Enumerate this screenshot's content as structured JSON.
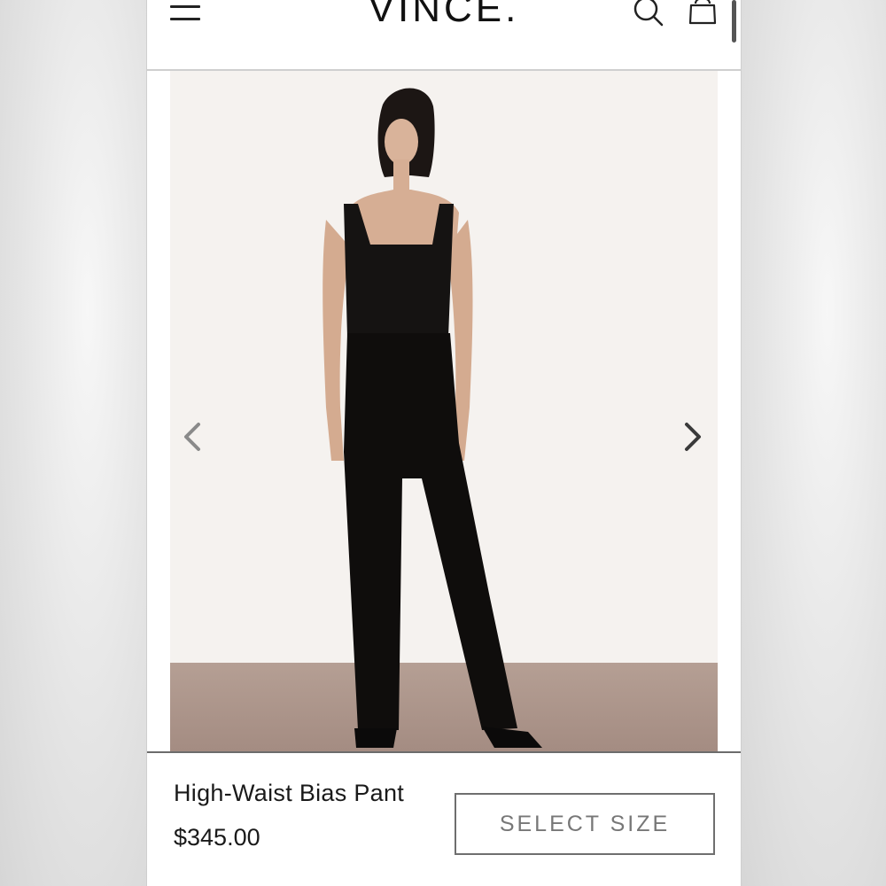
{
  "header": {
    "logo_text": "VINCE.",
    "menu_icon": "hamburger-menu-icon",
    "search_icon": "search-icon",
    "bag_icon": "shopping-bag-icon"
  },
  "gallery": {
    "prev_icon": "chevron-left-icon",
    "next_icon": "chevron-right-icon"
  },
  "product": {
    "name": "High-Waist Bias Pant",
    "price": "$345.00",
    "select_size_label": "SELECT SIZE"
  },
  "colors": {
    "text": "#1a1a1a",
    "button_border": "#6f6f6f",
    "button_text": "#777777",
    "photo_background": "#f5f2ef",
    "floor": "#a48c82"
  }
}
